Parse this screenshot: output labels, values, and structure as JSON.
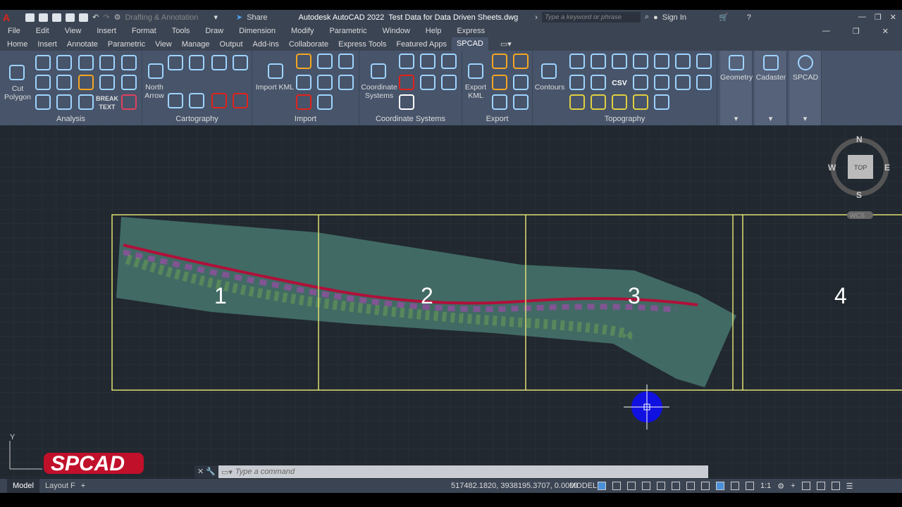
{
  "title": {
    "app": "Autodesk AutoCAD 2022",
    "file": "Test Data for Data Driven Sheets.dwg",
    "workspace": "Drafting & Annotation",
    "share": "Share",
    "search_placeholder": "Type a keyword or phrase",
    "sign_in": "Sign In"
  },
  "menu": [
    "File",
    "Edit",
    "View",
    "Insert",
    "Format",
    "Tools",
    "Draw",
    "Dimension",
    "Modify",
    "Parametric",
    "Window",
    "Help",
    "Express"
  ],
  "tabs": [
    "Home",
    "Insert",
    "Annotate",
    "Parametric",
    "View",
    "Manage",
    "Output",
    "Add-ins",
    "Collaborate",
    "Express Tools",
    "Featured Apps",
    "SPCAD"
  ],
  "active_tab": "SPCAD",
  "ribbon": {
    "analysis": {
      "label": "Analysis",
      "cut_polygon": "Cut Polygon",
      "break_text": "BREAK TEXT"
    },
    "cartography": {
      "label": "Cartography",
      "north_arrow": "North Arrow"
    },
    "import": {
      "label": "Import",
      "import_kml": "Import KML"
    },
    "coordinate_systems": {
      "label": "Coordinate Systems",
      "button": "Coordinate Systems"
    },
    "export": {
      "label": "Export",
      "export_kml": "Export KML"
    },
    "topography": {
      "label": "Topography",
      "contours": "Contours",
      "csv": "CSV"
    },
    "geometry": "Geometry",
    "cadaster": "Cadaster",
    "spcad": "SPCAD"
  },
  "viewcube": {
    "n": "N",
    "s": "S",
    "e": "E",
    "w": "W",
    "top": "TOP",
    "wcs": "WCS"
  },
  "sheets": [
    "1",
    "2",
    "3",
    "4"
  ],
  "ucs": {
    "y": "Y"
  },
  "logo": "SPCAD",
  "command": {
    "placeholder": "Type a command"
  },
  "status": {
    "layouts": [
      "Model",
      "Layout F"
    ],
    "coords": "517482.1820, 3938195.3707, 0.0000",
    "model": "MODEL",
    "scale": "1:1"
  }
}
